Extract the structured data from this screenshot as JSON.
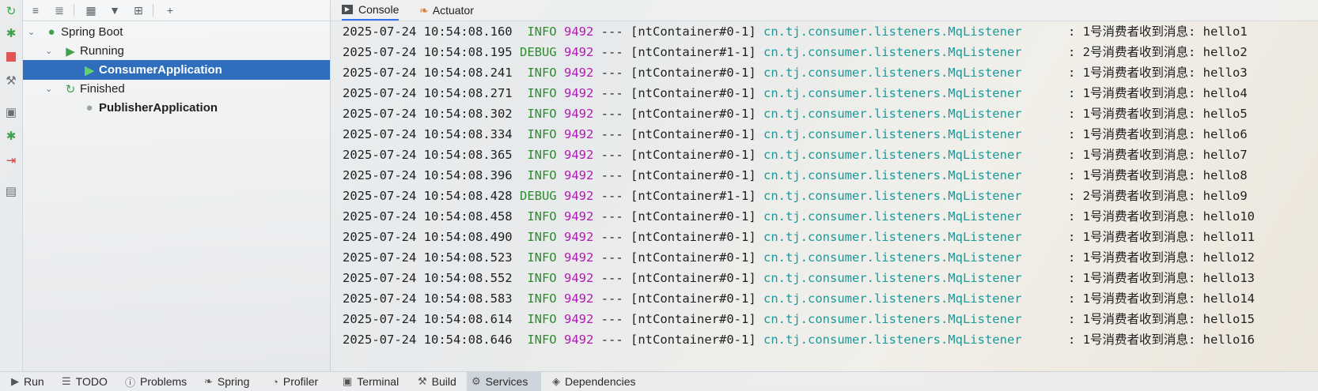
{
  "left_strip_icons": [
    "rerun-icon",
    "debug-icon",
    "stop-icon",
    "wrench-icon",
    "camera-icon",
    "debug-alt-icon",
    "exit-icon",
    "layout-icon"
  ],
  "tree_toolbar_icons": [
    "expand-all-icon",
    "collapse-all-icon",
    "group-by-icon",
    "filter-icon",
    "new-service-icon",
    "add-icon"
  ],
  "tree": {
    "spring_boot": "Spring Boot",
    "running": "Running",
    "consumer": "ConsumerApplication",
    "finished": "Finished",
    "publisher": "PublisherApplication"
  },
  "tabs": {
    "console": "Console",
    "actuator": "Actuator"
  },
  "log": [
    {
      "ts": "2025-07-24 10:54:08.160",
      "level": " INFO",
      "pid": "9492",
      "sep": "---",
      "thread": "[ntContainer#0-1]",
      "cls": "cn.tj.consumer.listeners.MqListener",
      "msg": ": 1号消费者收到消息: hello1"
    },
    {
      "ts": "2025-07-24 10:54:08.195",
      "level": "DEBUG",
      "pid": "9492",
      "sep": "---",
      "thread": "[ntContainer#1-1]",
      "cls": "cn.tj.consumer.listeners.MqListener",
      "msg": ": 2号消费者收到消息: hello2"
    },
    {
      "ts": "2025-07-24 10:54:08.241",
      "level": " INFO",
      "pid": "9492",
      "sep": "---",
      "thread": "[ntContainer#0-1]",
      "cls": "cn.tj.consumer.listeners.MqListener",
      "msg": ": 1号消费者收到消息: hello3"
    },
    {
      "ts": "2025-07-24 10:54:08.271",
      "level": " INFO",
      "pid": "9492",
      "sep": "---",
      "thread": "[ntContainer#0-1]",
      "cls": "cn.tj.consumer.listeners.MqListener",
      "msg": ": 1号消费者收到消息: hello4"
    },
    {
      "ts": "2025-07-24 10:54:08.302",
      "level": " INFO",
      "pid": "9492",
      "sep": "---",
      "thread": "[ntContainer#0-1]",
      "cls": "cn.tj.consumer.listeners.MqListener",
      "msg": ": 1号消费者收到消息: hello5"
    },
    {
      "ts": "2025-07-24 10:54:08.334",
      "level": " INFO",
      "pid": "9492",
      "sep": "---",
      "thread": "[ntContainer#0-1]",
      "cls": "cn.tj.consumer.listeners.MqListener",
      "msg": ": 1号消费者收到消息: hello6"
    },
    {
      "ts": "2025-07-24 10:54:08.365",
      "level": " INFO",
      "pid": "9492",
      "sep": "---",
      "thread": "[ntContainer#0-1]",
      "cls": "cn.tj.consumer.listeners.MqListener",
      "msg": ": 1号消费者收到消息: hello7"
    },
    {
      "ts": "2025-07-24 10:54:08.396",
      "level": " INFO",
      "pid": "9492",
      "sep": "---",
      "thread": "[ntContainer#0-1]",
      "cls": "cn.tj.consumer.listeners.MqListener",
      "msg": ": 1号消费者收到消息: hello8"
    },
    {
      "ts": "2025-07-24 10:54:08.428",
      "level": "DEBUG",
      "pid": "9492",
      "sep": "---",
      "thread": "[ntContainer#1-1]",
      "cls": "cn.tj.consumer.listeners.MqListener",
      "msg": ": 2号消费者收到消息: hello9"
    },
    {
      "ts": "2025-07-24 10:54:08.458",
      "level": " INFO",
      "pid": "9492",
      "sep": "---",
      "thread": "[ntContainer#0-1]",
      "cls": "cn.tj.consumer.listeners.MqListener",
      "msg": ": 1号消费者收到消息: hello10"
    },
    {
      "ts": "2025-07-24 10:54:08.490",
      "level": " INFO",
      "pid": "9492",
      "sep": "---",
      "thread": "[ntContainer#0-1]",
      "cls": "cn.tj.consumer.listeners.MqListener",
      "msg": ": 1号消费者收到消息: hello11"
    },
    {
      "ts": "2025-07-24 10:54:08.523",
      "level": " INFO",
      "pid": "9492",
      "sep": "---",
      "thread": "[ntContainer#0-1]",
      "cls": "cn.tj.consumer.listeners.MqListener",
      "msg": ": 1号消费者收到消息: hello12"
    },
    {
      "ts": "2025-07-24 10:54:08.552",
      "level": " INFO",
      "pid": "9492",
      "sep": "---",
      "thread": "[ntContainer#0-1]",
      "cls": "cn.tj.consumer.listeners.MqListener",
      "msg": ": 1号消费者收到消息: hello13"
    },
    {
      "ts": "2025-07-24 10:54:08.583",
      "level": " INFO",
      "pid": "9492",
      "sep": "---",
      "thread": "[ntContainer#0-1]",
      "cls": "cn.tj.consumer.listeners.MqListener",
      "msg": ": 1号消费者收到消息: hello14"
    },
    {
      "ts": "2025-07-24 10:54:08.614",
      "level": " INFO",
      "pid": "9492",
      "sep": "---",
      "thread": "[ntContainer#0-1]",
      "cls": "cn.tj.consumer.listeners.MqListener",
      "msg": ": 1号消费者收到消息: hello15"
    },
    {
      "ts": "2025-07-24 10:54:08.646",
      "level": " INFO",
      "pid": "9492",
      "sep": "---",
      "thread": "[ntContainer#0-1]",
      "cls": "cn.tj.consumer.listeners.MqListener",
      "msg": ": 1号消费者收到消息: hello16"
    }
  ],
  "bottom_bar": [
    {
      "label": "Run",
      "icon": "run-icon",
      "active": false
    },
    {
      "label": "TODO",
      "icon": "todo-icon",
      "active": false
    },
    {
      "label": "Problems",
      "icon": "problems-icon",
      "active": false
    },
    {
      "label": "Spring",
      "icon": "spring-icon",
      "active": false
    },
    {
      "label": "Profiler",
      "icon": "profiler-icon",
      "active": false
    },
    {
      "label": "Terminal",
      "icon": "terminal-icon",
      "active": false
    },
    {
      "label": "Build",
      "icon": "build-icon",
      "active": false
    },
    {
      "label": "Services",
      "icon": "services-icon",
      "active": true
    },
    {
      "label": "Dependencies",
      "icon": "dependencies-icon",
      "active": false
    }
  ],
  "colors": {
    "selection": "#2f6ebd",
    "accent": "#3574f0",
    "run_green": "#3fa34d",
    "log_class": "#1a9a9a",
    "log_pid": "#b01bb0",
    "log_level": "#2e8b2e"
  }
}
